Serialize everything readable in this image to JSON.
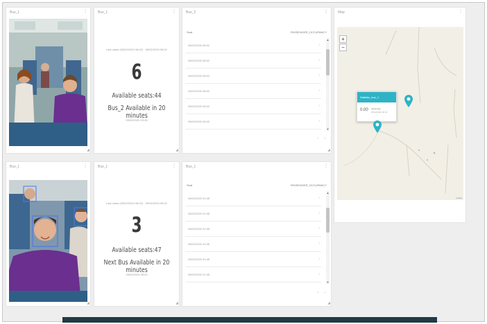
{
  "colors": {
    "accent": "#2eb3c6",
    "bottom_bar": "#1f3b44"
  },
  "row1": {
    "camera": {
      "title": "Bus_1"
    },
    "stats": {
      "title": "Bus_1",
      "last_value": "Last value (05/02/2020 08:02) · 05/02/2020 08:02",
      "count": "6",
      "line1": "Available seats:44",
      "line2": "Bus_2 Available in 20 minutes",
      "timestamp": "05/02/2020 20:45"
    },
    "table": {
      "title": "Bus_2",
      "col_left": "Seat",
      "col_right": "PASSENGER_OCCUPANCY",
      "rows": [
        "05/02/2020 08:02",
        "05/02/2020 08:02",
        "05/02/2020 08:02",
        "05/02/2020 08:02",
        "05/02/2020 08:02",
        "05/02/2020 08:02"
      ]
    }
  },
  "row2": {
    "camera": {
      "title": "Bus_1"
    },
    "stats": {
      "title": "Bus_1",
      "last_value": "Last value (05/02/2020 08:02) · 05/02/2020 08:02",
      "count": "3",
      "line1": "Available seats:47",
      "line2": "Next Bus Available in 20 minutes",
      "timestamp": "05/02/2020 08:02"
    },
    "table": {
      "title": "Bus_1",
      "col_left": "Seat",
      "col_right": "PASSENGER_OCCUPANCY",
      "rows": [
        "05/02/2020 20:45",
        "05/02/2020 20:45",
        "05/02/2020 20:45",
        "05/02/2020 20:45",
        "05/02/2020 20:45",
        "05/02/2020 20:45"
      ]
    }
  },
  "map": {
    "title": "Map",
    "zoom_in": "+",
    "zoom_out": "−",
    "popup": {
      "header": "Statistic_bus_1",
      "value": "0.00",
      "unit": "passenger",
      "time": "05/02/2020 08:02"
    },
    "attribution": "Leaflet"
  },
  "icons": {
    "menu": "more-vertical-icon",
    "pin": "map-pin-icon",
    "resize": "resize-corner-icon"
  }
}
